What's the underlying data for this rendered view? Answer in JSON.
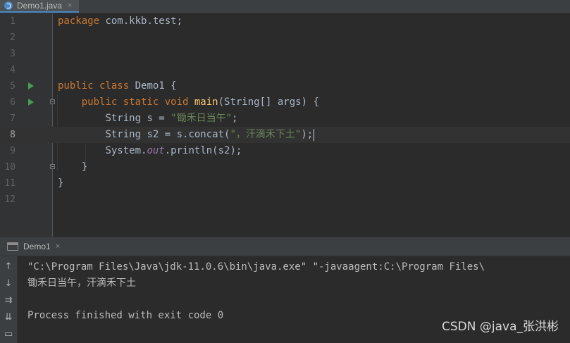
{
  "editor_tab": {
    "label": "Demo1.java",
    "close": "×"
  },
  "code_lines": [
    {
      "n": "1",
      "run": false,
      "fold": false,
      "current": false
    },
    {
      "n": "2",
      "run": false,
      "fold": false,
      "current": false
    },
    {
      "n": "3",
      "run": false,
      "fold": false,
      "current": false
    },
    {
      "n": "4",
      "run": false,
      "fold": false,
      "current": false
    },
    {
      "n": "5",
      "run": true,
      "fold": false,
      "current": false
    },
    {
      "n": "6",
      "run": true,
      "fold": true,
      "current": false
    },
    {
      "n": "7",
      "run": false,
      "fold": false,
      "current": false
    },
    {
      "n": "8",
      "run": false,
      "fold": false,
      "current": true
    },
    {
      "n": "9",
      "run": false,
      "fold": false,
      "current": false
    },
    {
      "n": "10",
      "run": false,
      "fold": true,
      "current": false
    },
    {
      "n": "11",
      "run": false,
      "fold": false,
      "current": false
    },
    {
      "n": "12",
      "run": false,
      "fold": false,
      "current": false
    }
  ],
  "code": {
    "l1_kw": "package",
    "l1_rest": " com.kkb.test;",
    "l5_kw": "public class",
    "l5_rest": " Demo1 {",
    "l6_indent": "    ",
    "l6_kw": "public static void",
    "l6_sp": " ",
    "l6_fn": "main",
    "l6_rest": "(String[] args) {",
    "l7_indent": "        ",
    "l7_pre": "String s = ",
    "l7_str": "\"锄禾日当午\"",
    "l7_post": ";",
    "l8_indent": "        ",
    "l8_pre": "String s2 = s.concat(",
    "l8_str": "\"，汗滴禾下土\"",
    "l8_post": ");",
    "l9_indent": "        ",
    "l9_pre": "System.",
    "l9_fld": "out",
    "l9_post": ".println(s2);",
    "l10": "    }",
    "l11": "}"
  },
  "run_window": {
    "tab_label": "Demo1",
    "tab_close": "×",
    "toolbar": [
      {
        "name": "up-arrow-icon",
        "glyph": "↑"
      },
      {
        "name": "down-arrow-icon",
        "glyph": "↓"
      },
      {
        "name": "soft-wrap-icon",
        "glyph": "⇉"
      },
      {
        "name": "scroll-to-end-icon",
        "glyph": "⇊"
      },
      {
        "name": "print-icon",
        "glyph": "▭"
      }
    ],
    "console_lines": [
      "\"C:\\Program Files\\Java\\jdk-11.0.6\\bin\\java.exe\" \"-javaagent:C:\\Program Files\\",
      "锄禾日当午，汗滴禾下土",
      "",
      "Process finished with exit code 0"
    ]
  },
  "watermark": "CSDN @java_张洪彬",
  "colors": {
    "background": "#2b2b2b",
    "gutter": "#313335",
    "keyword": "#cc7832",
    "function": "#ffc66d",
    "string": "#6a8759",
    "field": "#9876aa",
    "plain": "#a9b7c6",
    "run_icon": "#499c54"
  }
}
